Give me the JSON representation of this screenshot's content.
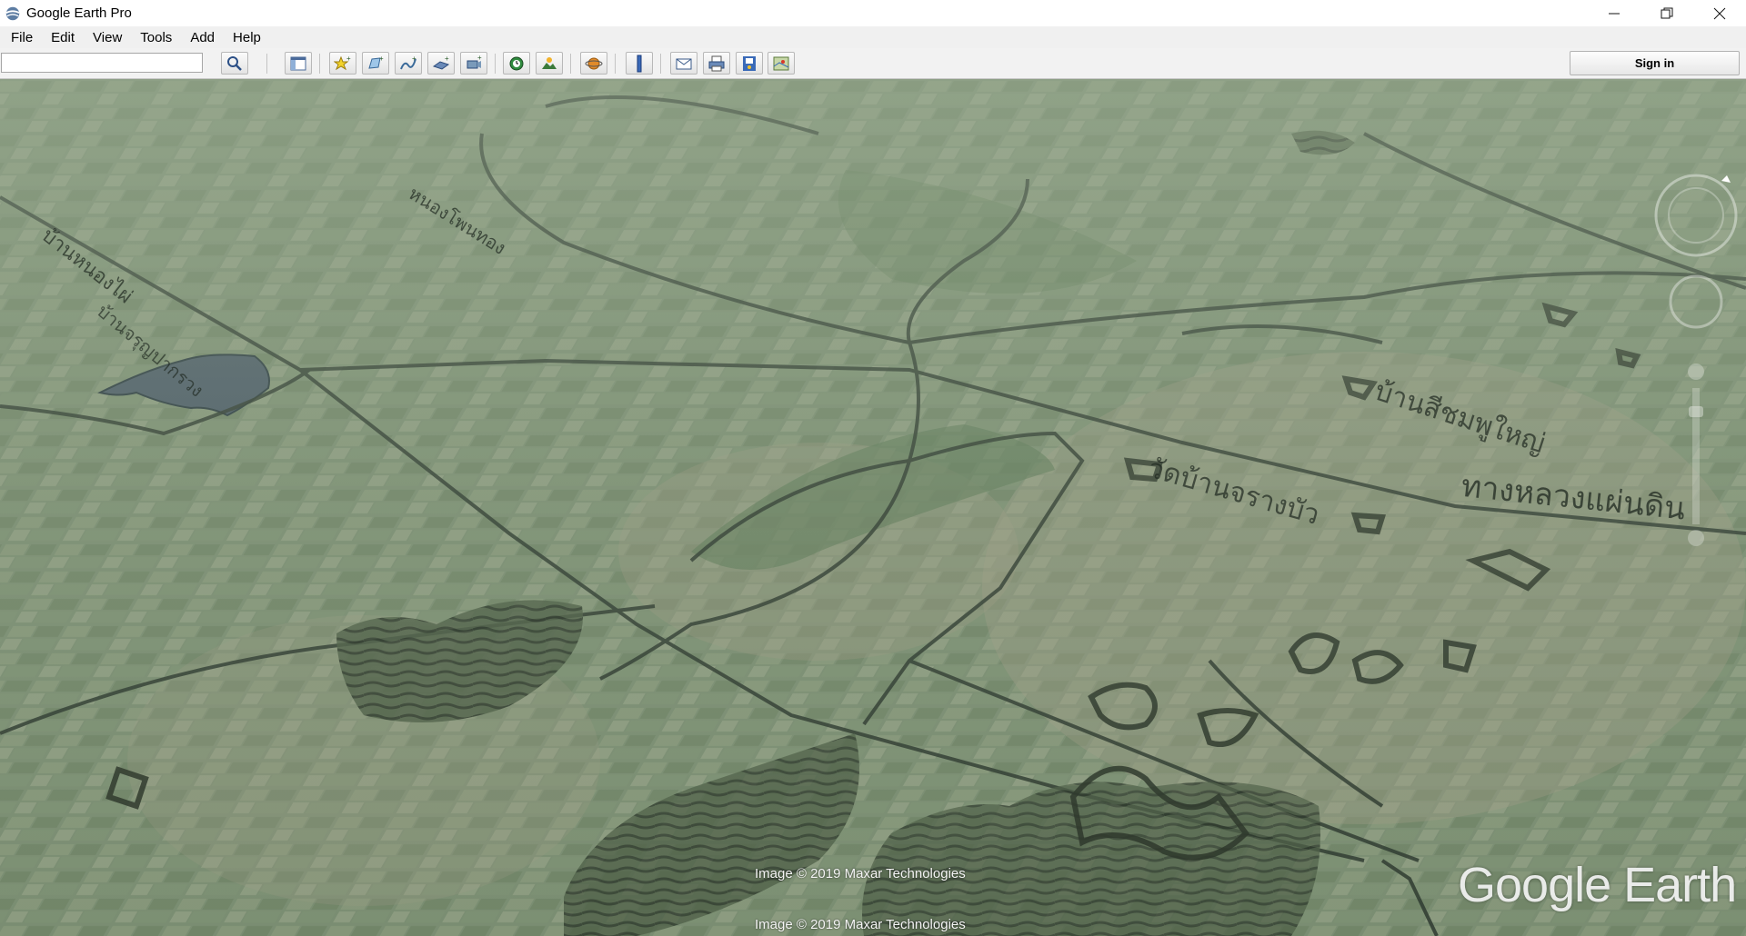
{
  "window": {
    "title": "Google Earth Pro",
    "controls": {
      "minimize": "—",
      "restore": "❐",
      "close": "✕"
    }
  },
  "menu": [
    {
      "label": "File"
    },
    {
      "label": "Edit"
    },
    {
      "label": "View"
    },
    {
      "label": "Tools"
    },
    {
      "label": "Add"
    },
    {
      "label": "Help"
    }
  ],
  "toolbar": {
    "search_value": "",
    "sign_in_label": "Sign in",
    "buttons": [
      "search-icon",
      "sidebar-toggle-icon",
      "add-placemark-icon",
      "add-polygon-icon",
      "add-path-icon",
      "add-image-overlay-icon",
      "record-tour-icon",
      "historical-imagery-icon",
      "sunlight-icon",
      "switch-planet-icon",
      "ruler-icon",
      "email-icon",
      "print-icon",
      "save-image-icon",
      "view-in-maps-icon"
    ]
  },
  "map": {
    "overlay_labels": [
      "บ้านหนองไผ่",
      "หนองโพนทอง",
      "บ้านจรุญปากรวง",
      "บ้านสีชมพูใหญ่",
      "วัดบ้านจรางบัว",
      "ทางหลวงแผ่นดิน"
    ],
    "credits": [
      "Image © 2019 Maxar Technologies",
      "Image © 2019 Maxar Technologies"
    ],
    "logo_text": "Google Earth"
  },
  "colors": {
    "terrain": "#6f8468",
    "overlay_lines": "#2e3a30",
    "water": "#4a5a66"
  }
}
